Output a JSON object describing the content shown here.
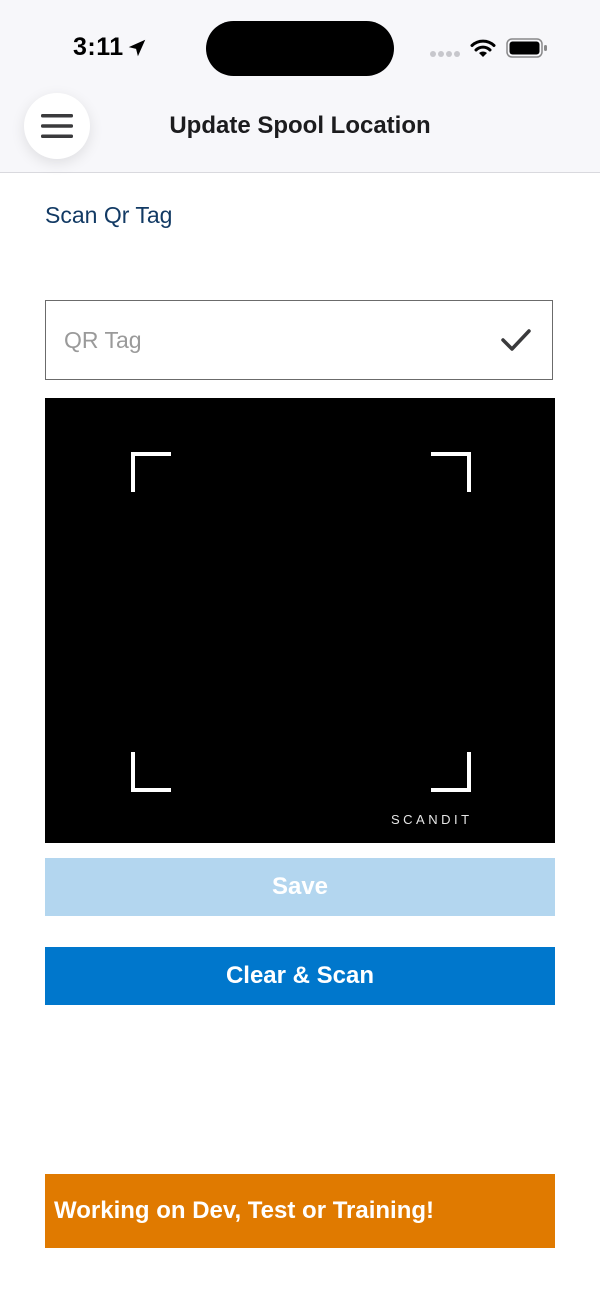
{
  "status_bar": {
    "time": "3:11",
    "icons": [
      "location-arrow-icon",
      "cellular-signal-icon",
      "wifi-icon",
      "battery-icon"
    ]
  },
  "header": {
    "title": "Update Spool Location",
    "menu_icon": "hamburger-menu-icon"
  },
  "scan_section": {
    "label": "Scan Qr Tag",
    "qr_input": {
      "value": "",
      "placeholder": "QR Tag"
    },
    "confirm_icon": "checkmark-icon",
    "scanner_brand": "SCANDIT"
  },
  "actions": {
    "save_label": "Save",
    "clear_scan_label": "Clear & Scan"
  },
  "environment_banner": "Working on Dev, Test or Training!",
  "colors": {
    "primary": "#0077cc",
    "primary_disabled": "#b3d6ef",
    "banner": "#e07a00",
    "label_text": "#123a64"
  }
}
